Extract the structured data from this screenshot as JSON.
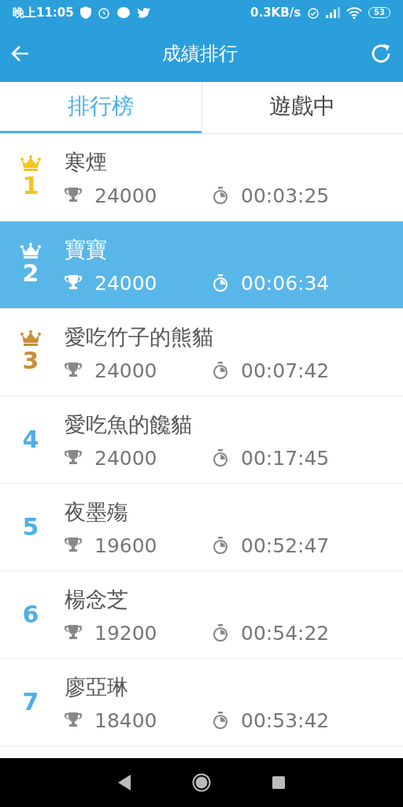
{
  "status_bar": {
    "time": "晚上11:05",
    "speed": "0.3KB/s",
    "battery": "53"
  },
  "app_bar": {
    "title": "成績排行"
  },
  "tabs": [
    {
      "label": "排行榜",
      "selected": true
    },
    {
      "label": "遊戲中",
      "selected": false
    }
  ],
  "rows": [
    {
      "rank": "1",
      "crowned": true,
      "color": "#f6c21c",
      "name": "寒煙",
      "score": "24000",
      "time": "00:03:25",
      "selected": false
    },
    {
      "rank": "2",
      "crowned": true,
      "color": "#ffffff",
      "name": "寶寶",
      "score": "24000",
      "time": "00:06:34",
      "selected": true
    },
    {
      "rank": "3",
      "crowned": true,
      "color": "#c98f3a",
      "name": "愛吃竹子的熊貓",
      "score": "24000",
      "time": "00:07:42",
      "selected": false
    },
    {
      "rank": "4",
      "crowned": false,
      "color": "#4eb0e6",
      "name": "愛吃魚的饞貓",
      "score": "24000",
      "time": "00:17:45",
      "selected": false
    },
    {
      "rank": "5",
      "crowned": false,
      "color": "#4eb0e6",
      "name": "夜墨殤",
      "score": "19600",
      "time": "00:52:47",
      "selected": false
    },
    {
      "rank": "6",
      "crowned": false,
      "color": "#4eb0e6",
      "name": "楊念芝",
      "score": "19200",
      "time": "00:54:22",
      "selected": false
    },
    {
      "rank": "7",
      "crowned": false,
      "color": "#4eb0e6",
      "name": "廖亞琳",
      "score": "18400",
      "time": "00:53:42",
      "selected": false
    }
  ]
}
